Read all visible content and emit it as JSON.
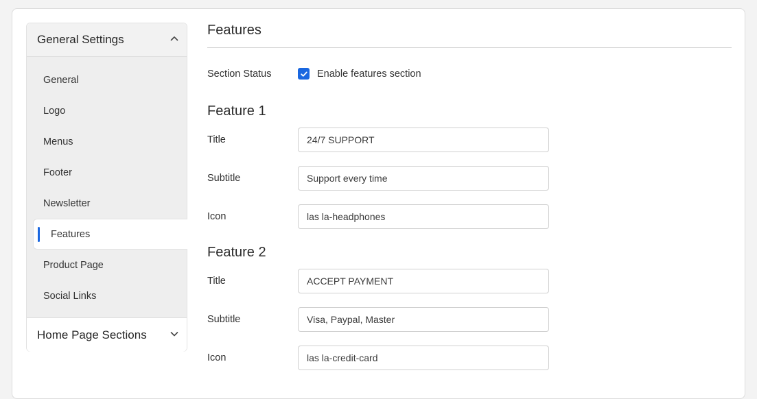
{
  "sidebar": {
    "group1": {
      "title": "General Settings",
      "items": [
        {
          "label": "General"
        },
        {
          "label": "Logo"
        },
        {
          "label": "Menus"
        },
        {
          "label": "Footer"
        },
        {
          "label": "Newsletter"
        },
        {
          "label": "Features",
          "active": true
        },
        {
          "label": "Product Page"
        },
        {
          "label": "Social Links"
        }
      ]
    },
    "group2": {
      "title": "Home Page Sections"
    }
  },
  "main": {
    "title": "Features",
    "section_status": {
      "label": "Section Status",
      "checkbox_label": "Enable features section",
      "checked": true
    },
    "features": [
      {
        "heading": "Feature 1",
        "fields": [
          {
            "label": "Title",
            "value": "24/7 SUPPORT"
          },
          {
            "label": "Subtitle",
            "value": "Support every time"
          },
          {
            "label": "Icon",
            "value": "las la-headphones"
          }
        ]
      },
      {
        "heading": "Feature 2",
        "fields": [
          {
            "label": "Title",
            "value": "ACCEPT PAYMENT"
          },
          {
            "label": "Subtitle",
            "value": "Visa, Paypal, Master"
          },
          {
            "label": "Icon",
            "value": "las la-credit-card"
          }
        ]
      }
    ]
  },
  "colors": {
    "accent": "#1a67e0"
  },
  "icons": {
    "collapse": "chevron-up-icon",
    "expand": "chevron-down-icon",
    "check": "checkmark-icon"
  }
}
